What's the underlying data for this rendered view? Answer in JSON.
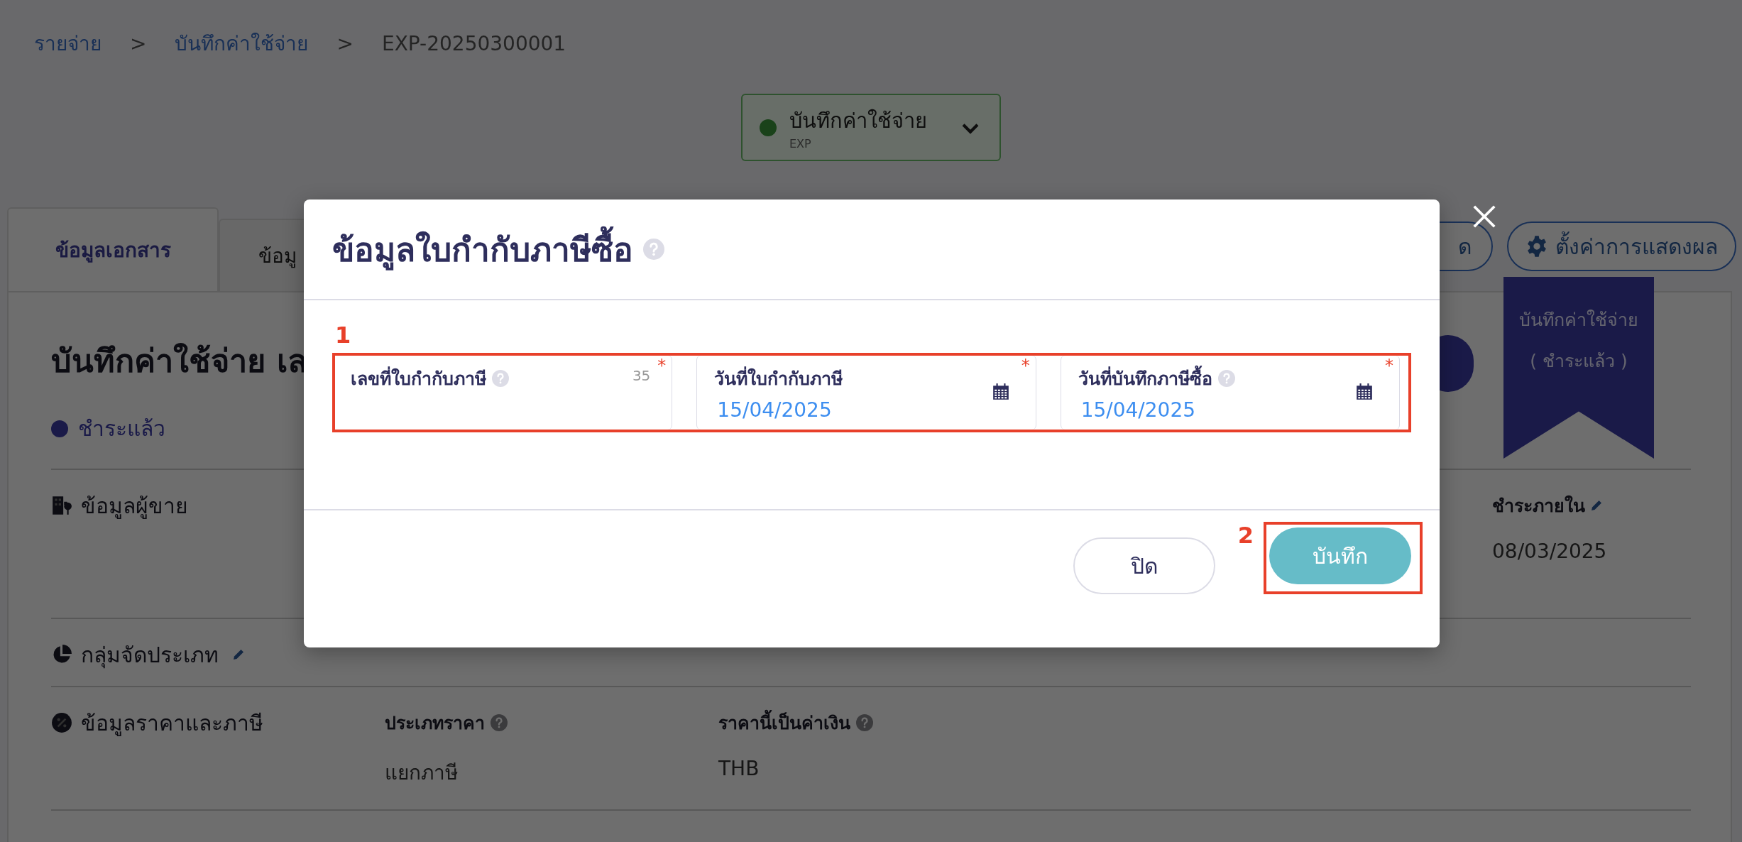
{
  "breadcrumb": [
    {
      "label": "รายจ่าย",
      "kind": "link"
    },
    {
      "label": ">",
      "kind": "separator"
    },
    {
      "label": "บันทึกค่าใช้จ่าย",
      "kind": "link"
    },
    {
      "label": ">",
      "kind": "separator"
    },
    {
      "label": "EXP-20250300001",
      "kind": "current"
    }
  ],
  "status_dropdown": {
    "label": "บันทึกค่าใช้จ่าย",
    "code": "EXP"
  },
  "tabs": [
    {
      "label": "ข้อมูลเอกสาร",
      "selected": true
    },
    {
      "label": "ข้อมู",
      "selected": false
    }
  ],
  "toolbar_buttons": [
    {
      "label": "ด",
      "kind": "outline"
    },
    {
      "label": "ตั้งค่าการแสดงผล",
      "kind": "settings"
    }
  ],
  "ribbon": {
    "lines": [
      "บันทึกค่าใช้จ่าย",
      "( ชำระแล้ว )"
    ]
  },
  "document": {
    "title": "บันทึกค่าใช้จ่าย เล",
    "status": "ชำระแล้ว",
    "sections": [
      {
        "title": "ข้อมูลผู้ขาย",
        "kind": "vendor",
        "editable": false,
        "fields": [
          {
            "label": "ชำระภายใน",
            "help": false,
            "editable": true,
            "value": "08/03/2025"
          }
        ]
      },
      {
        "title": "กลุ่มจัดประเภท",
        "kind": "category",
        "editable": true
      },
      {
        "title": "ข้อมูลราคาและภาษี",
        "kind": "pricing",
        "editable": false,
        "fields": [
          {
            "label": "ประเภทราคา",
            "help": true,
            "editable": false,
            "value": "แยกภาษี"
          },
          {
            "label": "ราคานี้เป็นค่าเงิน",
            "help": true,
            "editable": false,
            "value": "THB"
          }
        ]
      }
    ]
  },
  "modal": {
    "title": "ข้อมูลใบกำกับภาษีซื้อ",
    "help": true,
    "fields_annotation": "1",
    "fields": [
      {
        "label": "เลขที่ใบกำกับภาษี",
        "help": true,
        "counter": "35",
        "required_mark": "*",
        "kind": "text"
      },
      {
        "label": "วันที่ใบกำกับภาษี",
        "help": false,
        "value": "15/04/2025",
        "required_mark": "*",
        "kind": "date"
      },
      {
        "label": "วันที่บันทึกภาษีซื้อ",
        "help": true,
        "value": "15/04/2025",
        "required_mark": "*",
        "kind": "date"
      }
    ],
    "buttons": [
      {
        "label": "ปิด",
        "kind": "secondary"
      },
      {
        "label": "บันทึก",
        "kind": "primary",
        "annotation": "2"
      }
    ]
  }
}
